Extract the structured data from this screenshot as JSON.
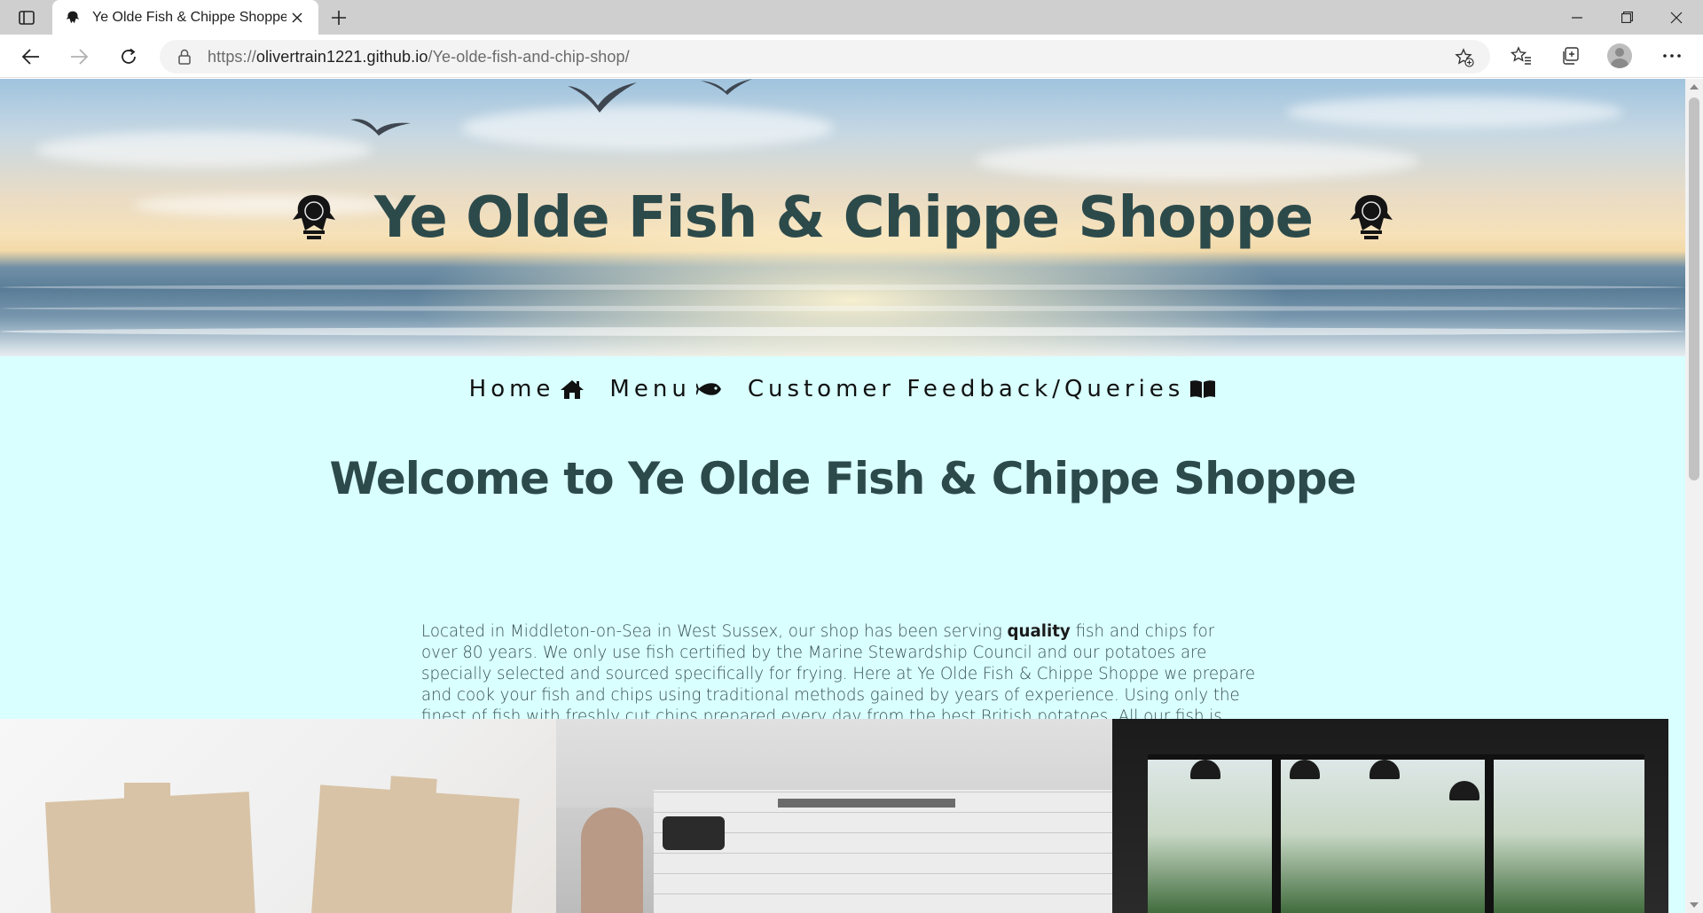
{
  "browser": {
    "tab_title": "Ye Olde Fish & Chippe Shoppe",
    "url_prefix": "https://",
    "url_host": "olivertrain1221.github.io",
    "url_path": "/Ye-olde-fish-and-chip-shop/",
    "icons": [
      "tab-actions-icon",
      "close-icon",
      "new-tab-icon",
      "minimize-icon",
      "restore-icon",
      "window-close-icon",
      "back-icon",
      "forward-icon",
      "reload-icon",
      "lock-icon",
      "add-favorite-icon",
      "favorites-icon",
      "collections-icon",
      "profile-icon",
      "more-icon"
    ]
  },
  "hero": {
    "title": "Ye Olde Fish & Chippe Shoppe"
  },
  "nav": {
    "home": "Home",
    "menu": "Menu",
    "feedback": "Customer Feedback/Queries",
    "icons": [
      "home-icon",
      "fish-icon",
      "book-icon"
    ]
  },
  "main": {
    "heading": "Welcome to Ye Olde Fish & Chippe Shoppe",
    "intro_before": "Located in Middleton-on-Sea in West Sussex, our shop has been serving ",
    "intro_bold": "quality",
    "intro_after": " fish and chips for over 80 years. We only use fish certified by the Marine Stewardship Council and our potatoes are specially selected and sourced specifically for frying. Here at Ye Olde Fish & Chippe Shoppe we prepare and cook your fish and chips using traditional methods gained by years of experience. Using only the finest of fish with freshly cut chips prepared every day from the best British potatoes. All our fish is freshly cooked for you. Our top of the range cooking technology is computer controlled and features built-in oil filtration to ensure a good fry everytime. We can even fry your fish in gluten free batter if required, just let us know in advance! From all of us here, we look forward to welcoming you to the shop and feeding you soon!"
  },
  "colors": {
    "page_bg": "#d9ffff",
    "title_color": "#2d4a4b"
  }
}
